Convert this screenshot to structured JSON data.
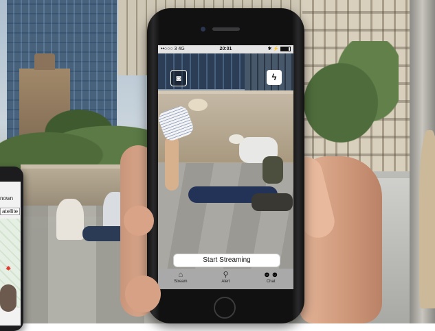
{
  "status_bar": {
    "carrier": "••○○○ 3  4G",
    "time": "20:01",
    "indicators": "✱ ⚡"
  },
  "camera_toolbar": {
    "camera_icon": "camera-icon",
    "flash_icon": "flash-icon"
  },
  "stream_button": {
    "label": "Start Streaming"
  },
  "tab_bar": {
    "tabs": [
      {
        "label": "Stream",
        "icon": "stream-icon"
      },
      {
        "label": "Alert",
        "icon": "alert-joystick-icon"
      },
      {
        "label": "Chat",
        "icon": "chat-people-icon",
        "active": true
      }
    ]
  },
  "second_phone": {
    "line1": "nown",
    "map_type": "atellite"
  }
}
